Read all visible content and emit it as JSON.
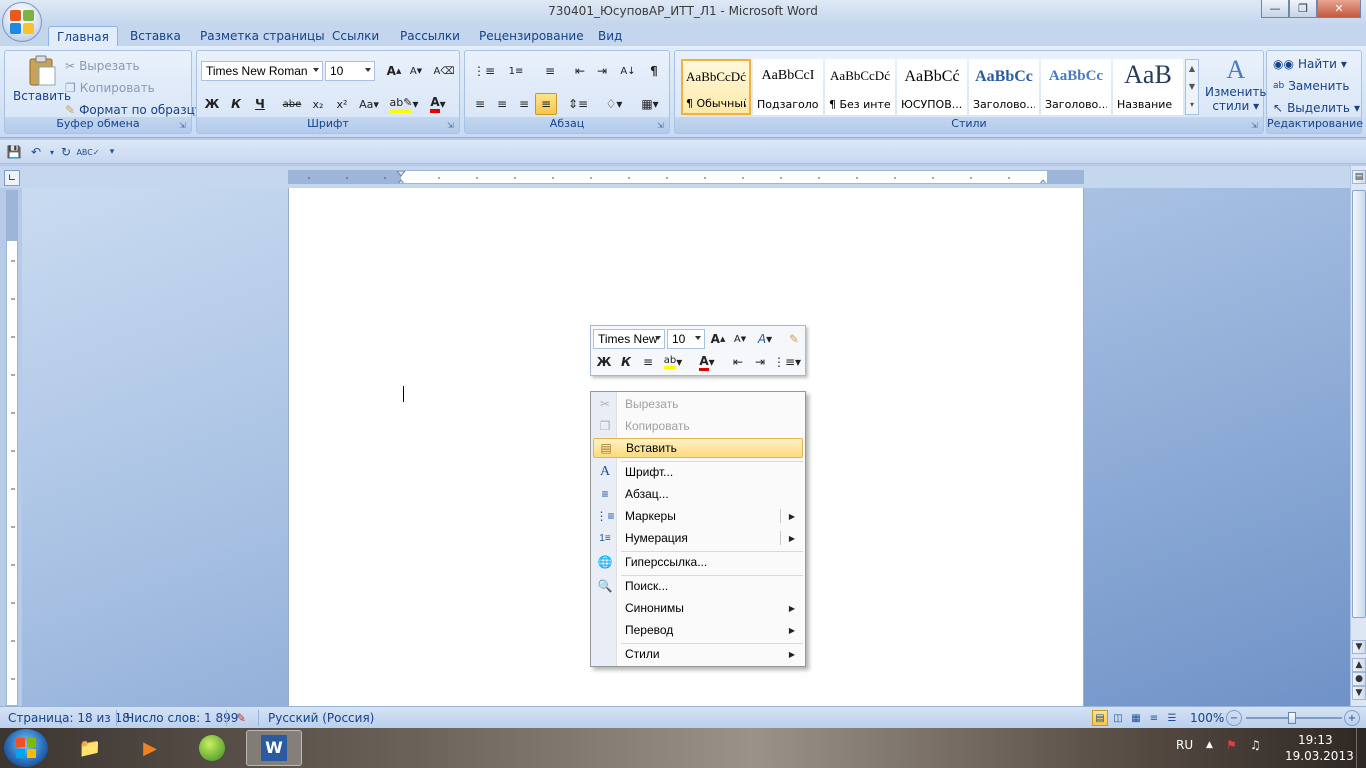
{
  "window": {
    "title": "730401_ЮсуповАР_ИТТ_Л1 - Microsoft Word"
  },
  "tabs": [
    {
      "label": "Главная"
    },
    {
      "label": "Вставка"
    },
    {
      "label": "Разметка страницы"
    },
    {
      "label": "Ссылки"
    },
    {
      "label": "Рассылки"
    },
    {
      "label": "Рецензирование"
    },
    {
      "label": "Вид"
    }
  ],
  "ribbon": {
    "clipboard": {
      "paste": "Вставить",
      "cut": "Вырезать",
      "copy": "Копировать",
      "format_painter": "Формат по образцу",
      "label": "Буфер обмена"
    },
    "font": {
      "font_name": "Times New Roman",
      "font_size": "10",
      "label": "Шрифт",
      "bold": "Ж",
      "italic": "К",
      "underline": "Ч",
      "strike": "abe",
      "subscript": "x₂",
      "superscript": "x²",
      "case": "Aa",
      "grow": "A",
      "shrink": "A"
    },
    "paragraph": {
      "label": "Абзац",
      "pilcrow": "¶"
    },
    "styles": {
      "label": "Стили",
      "items": [
        {
          "sample": "AaBbCcDć",
          "name": "¶ Обычный"
        },
        {
          "sample": "AaBbCcI",
          "name": "Подзаголо..."
        },
        {
          "sample": "AaBbCcDć",
          "name": "¶ Без инте..."
        },
        {
          "sample": "AaBbCć",
          "name": "ЮСУПОВ...."
        },
        {
          "sample": "AaBbCc",
          "name": "Заголово..."
        },
        {
          "sample": "AaBbCc",
          "name": "Заголово..."
        },
        {
          "sample": "AaB",
          "name": "Название"
        }
      ],
      "change_styles_1": "Изменить",
      "change_styles_2": "стили"
    },
    "editing": {
      "label": "Редактирование",
      "find": "Найти",
      "replace": "Заменить",
      "select": "Выделить"
    }
  },
  "mini_toolbar": {
    "font_name": "Times New",
    "font_size": "10",
    "bold": "Ж",
    "italic": "К"
  },
  "context_menu": {
    "items": [
      {
        "label": "Вырезать",
        "icon": "scissors-icon",
        "disabled": true
      },
      {
        "label": "Копировать",
        "icon": "copy-icon",
        "disabled": true
      },
      {
        "label": "Вставить",
        "icon": "paste-icon",
        "highlighted": true
      },
      {
        "label": "Шрифт...",
        "icon": "font-icon"
      },
      {
        "label": "Абзац...",
        "icon": "paragraph-icon"
      },
      {
        "label": "Маркеры",
        "icon": "bullets-icon",
        "submenu": true
      },
      {
        "label": "Нумерация",
        "icon": "numbering-icon",
        "submenu": true
      },
      {
        "label": "Гиперссылка...",
        "icon": "hyperlink-icon"
      },
      {
        "label": "Поиск...",
        "icon": "research-icon"
      },
      {
        "label": "Синонимы",
        "submenu": true
      },
      {
        "label": "Перевод",
        "submenu": true
      },
      {
        "label": "Стили",
        "submenu": true
      }
    ]
  },
  "statusbar": {
    "page": "Страница: 18 из 18",
    "words": "Число слов: 1 899",
    "language": "Русский (Россия)",
    "zoom": "100%"
  },
  "taskbar": {
    "lang": "RU",
    "time": "19:13",
    "date": "19.03.2013"
  },
  "colors": {
    "ribbon_text": "#15428b",
    "highlight": "#fcd97f",
    "font_color_red": "#e00000",
    "highlighter_yellow": "#ffff00"
  }
}
